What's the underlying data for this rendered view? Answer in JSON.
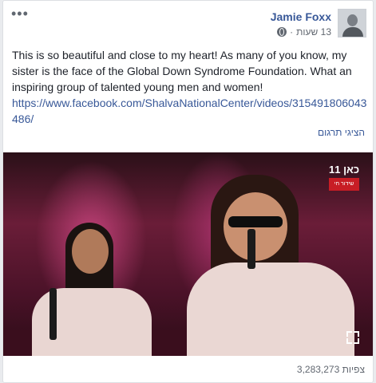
{
  "post": {
    "author": "Jamie Foxx",
    "time": "13 שעות",
    "text_lines": [
      "This is so beautiful and close to my heart! As many of you know, my",
      "sister is the face of the Global Down Syndrome Foundation. What an",
      "inspiring group of talented young men and women!"
    ],
    "link_lines": [
      "https://www.facebook.com/ShalvaNationalCenter/videos/315491806043",
      "486/"
    ],
    "translate_label": "הציגי תרגום",
    "views": "3,283,273 צפיות",
    "more_label": "•••"
  },
  "video": {
    "logo_main": "כאן 11",
    "logo_sub": "שידור חי"
  },
  "icons": {
    "privacy": "globe-icon",
    "menu": "more-options-icon",
    "fullscreen": "expand-icon",
    "avatar": "profile-avatar"
  },
  "colors": {
    "link": "#385898",
    "text": "#1d2129",
    "meta": "#616770"
  }
}
